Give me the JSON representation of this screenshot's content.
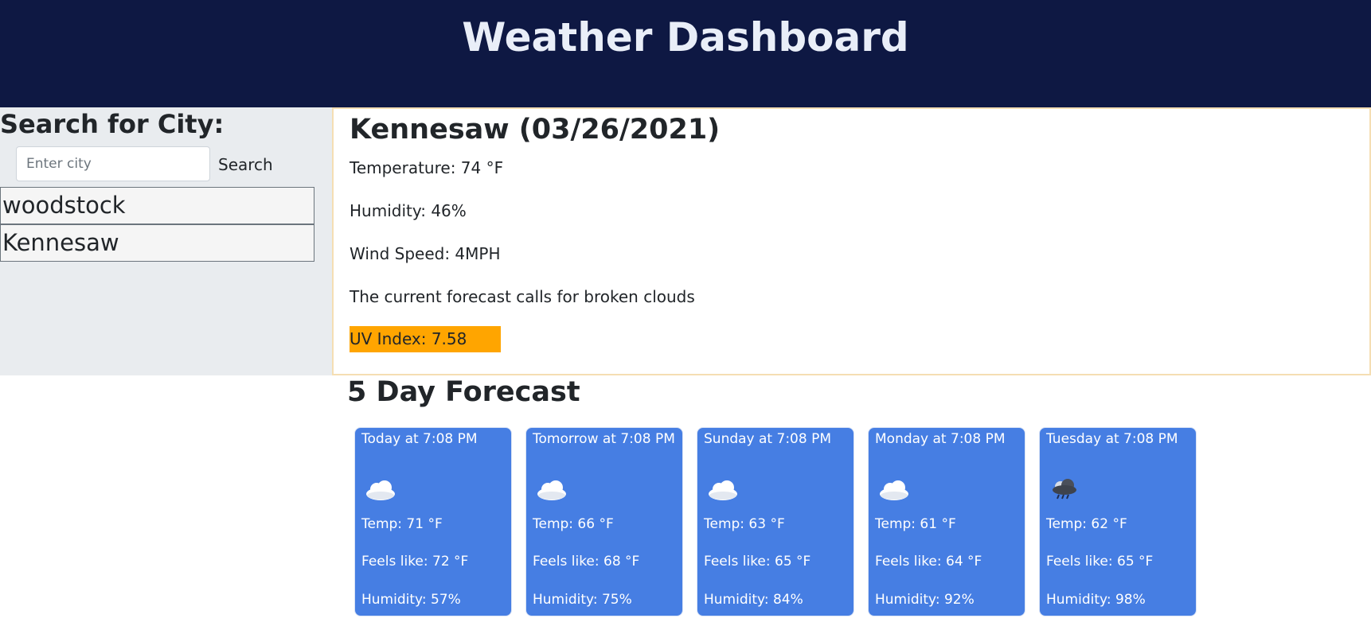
{
  "header": {
    "title": "Weather Dashboard"
  },
  "sidebar": {
    "title": "Search for City:",
    "search_placeholder": "Enter city",
    "search_button": "Search",
    "history": [
      "woodstock",
      "Kennesaw"
    ]
  },
  "current": {
    "heading": "Kennesaw (03/26/2021)",
    "temperature": "Temperature: 74 °F",
    "humidity": "Humidity: 46%",
    "wind": "Wind Speed: 4MPH",
    "description": "The current forecast calls for broken clouds",
    "uv": "UV Index: 7.58",
    "uv_color": "#ffa500"
  },
  "forecast": {
    "title": "5 Day Forecast",
    "days": [
      {
        "date": "Today at 7:08 PM",
        "icon": "cloud-icon",
        "temp": "Temp: 71 °F",
        "feels": "Feels like: 72 °F",
        "humidity": "Humidity: 57%"
      },
      {
        "date": "Tomorrow at 7:08 PM",
        "icon": "cloud-icon",
        "temp": "Temp: 66 °F",
        "feels": "Feels like: 68 °F",
        "humidity": "Humidity: 75%"
      },
      {
        "date": "Sunday at 7:08 PM",
        "icon": "cloud-icon",
        "temp": "Temp: 63 °F",
        "feels": "Feels like: 65 °F",
        "humidity": "Humidity: 84%"
      },
      {
        "date": "Monday at 7:08 PM",
        "icon": "cloud-icon",
        "temp": "Temp: 61 °F",
        "feels": "Feels like: 64 °F",
        "humidity": "Humidity: 92%"
      },
      {
        "date": "Tuesday at 7:08 PM",
        "icon": "rain-cloud-icon",
        "temp": "Temp: 62 °F",
        "feels": "Feels like: 65 °F",
        "humidity": "Humidity: 98%"
      }
    ]
  },
  "colors": {
    "header_bg": "#0e1843",
    "card_bg": "#467ee3",
    "sidebar_bg": "#e9ecef"
  }
}
